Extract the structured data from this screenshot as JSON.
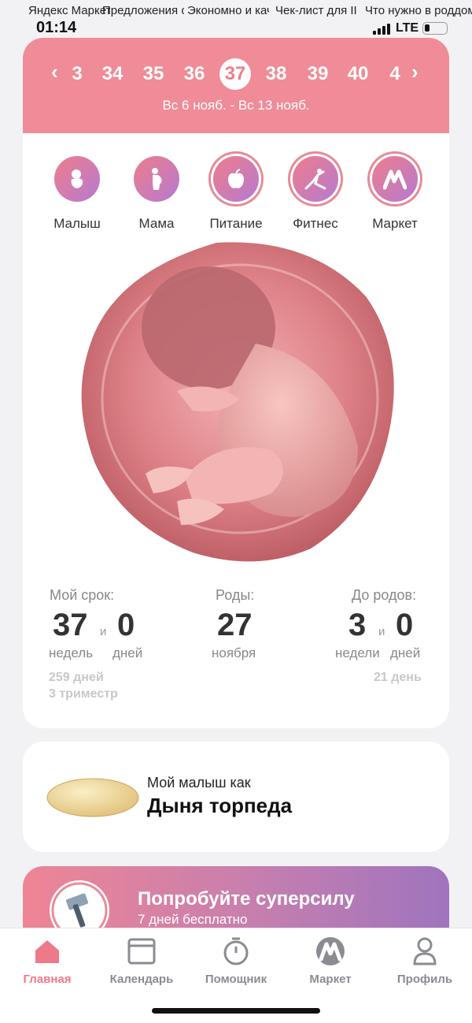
{
  "status_bar": {
    "time": "01:14",
    "network": "LTE",
    "overlay_tabs": [
      "Яндекс Маркет: ...",
      "Предложения от Янде...",
      "Экономно и качествен...",
      "Чек-лист для III три...",
      "Что нужно в роддом: покуп..."
    ]
  },
  "week_nav": {
    "prev_icon": "chevron-left-icon",
    "next_icon": "chevron-right-icon",
    "weeks": [
      "3",
      "34",
      "35",
      "36",
      "37",
      "38",
      "39",
      "40",
      "4"
    ],
    "current_week": "37",
    "date_range": "Вс 6 нояб. - Вс 13 нояб."
  },
  "categories": [
    {
      "label": "Малыш",
      "icon": "baby-icon"
    },
    {
      "label": "Мама",
      "icon": "pregnant-woman-icon"
    },
    {
      "label": "Питание",
      "icon": "apple-icon"
    },
    {
      "label": "Фитнес",
      "icon": "fitness-icon"
    },
    {
      "label": "Маркет",
      "icon": "market-logo-icon"
    }
  ],
  "stats": {
    "term": {
      "label": "Мой срок:",
      "weeks": "37",
      "days": "0",
      "conj": "и",
      "weeks_unit": "недель",
      "days_unit": "дней",
      "total_days": "259 дней",
      "trimester": "3 триместр"
    },
    "birth": {
      "label": "Роды:",
      "day": "27",
      "month": "ноября"
    },
    "until": {
      "label": "До родов:",
      "weeks": "3",
      "days": "0",
      "conj": "и",
      "weeks_unit": "недели",
      "days_unit": "дней",
      "total_days": "21 день"
    }
  },
  "baby_size": {
    "caption": "Мой малыш как",
    "name": "Дыня торпеда"
  },
  "promo": {
    "title": "Попробуйте суперсилу",
    "subtitle": "7 дней бесплатно"
  },
  "bottom_nav": [
    {
      "label": "Главная",
      "icon": "home-icon",
      "active": true
    },
    {
      "label": "Календарь",
      "icon": "calendar-icon",
      "active": false
    },
    {
      "label": "Помощник",
      "icon": "timer-icon",
      "active": false
    },
    {
      "label": "Маркет",
      "icon": "market-logo-icon",
      "active": false
    },
    {
      "label": "Профиль",
      "icon": "profile-icon",
      "active": false
    }
  ],
  "colors": {
    "accent": "#ef8c97",
    "active_nav": "#ec7a89",
    "gradient_start": "#ef7d8c",
    "gradient_end": "#b57ad0"
  }
}
